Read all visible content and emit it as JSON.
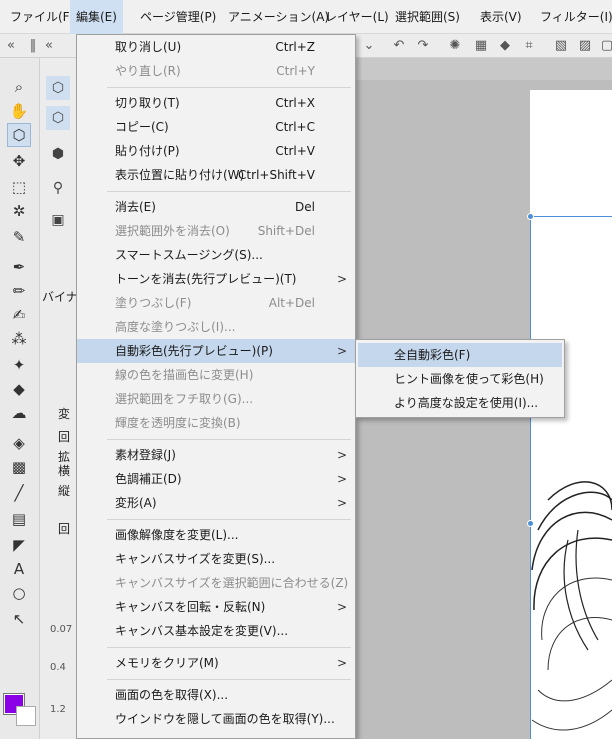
{
  "menubar": {
    "items": [
      {
        "label": "ファイル(F)"
      },
      {
        "label": "編集(E)"
      },
      {
        "label": "ページ管理(P)"
      },
      {
        "label": "アニメーション(A)"
      },
      {
        "label": "レイヤー(L)"
      },
      {
        "label": "選択範囲(S)"
      },
      {
        "label": "表示(V)"
      },
      {
        "label": "フィルター(I)"
      }
    ],
    "active_index": 1
  },
  "edit_menu": {
    "items": [
      {
        "label": "取り消し(U)",
        "shortcut": "Ctrl+Z",
        "enabled": true
      },
      {
        "label": "やり直し(R)",
        "shortcut": "Ctrl+Y",
        "enabled": false
      },
      {
        "label": "切り取り(T)",
        "shortcut": "Ctrl+X",
        "enabled": true
      },
      {
        "label": "コピー(C)",
        "shortcut": "Ctrl+C",
        "enabled": true
      },
      {
        "label": "貼り付け(P)",
        "shortcut": "Ctrl+V",
        "enabled": true
      },
      {
        "label": "表示位置に貼り付け(W)",
        "shortcut": "Ctrl+Shift+V",
        "enabled": true
      },
      {
        "label": "消去(E)",
        "shortcut": "Del",
        "enabled": true
      },
      {
        "label": "選択範囲外を消去(O)",
        "shortcut": "Shift+Del",
        "enabled": false
      },
      {
        "label": "スマートスムージング(S)...",
        "shortcut": "",
        "enabled": true
      },
      {
        "label": "トーンを消去(先行プレビュー)(T)",
        "shortcut": "",
        "enabled": true,
        "submenu": true
      },
      {
        "label": "塗りつぶし(F)",
        "shortcut": "Alt+Del",
        "enabled": false
      },
      {
        "label": "高度な塗りつぶし(I)...",
        "shortcut": "",
        "enabled": false
      },
      {
        "label": "自動彩色(先行プレビュー)(P)",
        "shortcut": "",
        "enabled": true,
        "submenu": true,
        "highlighted": true
      },
      {
        "label": "線の色を描画色に変更(H)",
        "shortcut": "",
        "enabled": false
      },
      {
        "label": "選択範囲をフチ取り(G)...",
        "shortcut": "",
        "enabled": false
      },
      {
        "label": "輝度を透明度に変換(B)",
        "shortcut": "",
        "enabled": false
      },
      {
        "label": "素材登録(J)",
        "shortcut": "",
        "enabled": true,
        "submenu": true
      },
      {
        "label": "色調補正(D)",
        "shortcut": "",
        "enabled": true,
        "submenu": true
      },
      {
        "label": "変形(A)",
        "shortcut": "",
        "enabled": true,
        "submenu": true
      },
      {
        "label": "画像解像度を変更(L)...",
        "shortcut": "",
        "enabled": true
      },
      {
        "label": "キャンバスサイズを変更(S)...",
        "shortcut": "",
        "enabled": true
      },
      {
        "label": "キャンバスサイズを選択範囲に合わせる(Z)",
        "shortcut": "",
        "enabled": false
      },
      {
        "label": "キャンバスを回転・反転(N)",
        "shortcut": "",
        "enabled": true,
        "submenu": true
      },
      {
        "label": "キャンバス基本設定を変更(V)...",
        "shortcut": "",
        "enabled": true
      },
      {
        "label": "メモリをクリア(M)",
        "shortcut": "",
        "enabled": true,
        "submenu": true
      },
      {
        "label": "画面の色を取得(X)...",
        "shortcut": "",
        "enabled": true
      },
      {
        "label": "ウインドウを隠して画面の色を取得(Y)...",
        "shortcut": "",
        "enabled": true
      }
    ],
    "submenu_arrow": ">"
  },
  "auto_color_submenu": {
    "items": [
      {
        "label": "全自動彩色(F)",
        "highlighted": true
      },
      {
        "label": "ヒント画像を使って彩色(H)",
        "highlighted": false
      },
      {
        "label": "より高度な設定を使用(I)...",
        "highlighted": false
      }
    ]
  },
  "side_panel": {
    "labels": [
      "バイナ",
      "変",
      "回",
      "拡",
      "横",
      "縦",
      "回"
    ],
    "numbers": [
      "0.07",
      "0.4",
      "1.2"
    ]
  },
  "colors": {
    "menu_highlight": "#c4d7ec",
    "drawing_color": "#8a00e6",
    "selection_blue": "#4d8fd6"
  }
}
